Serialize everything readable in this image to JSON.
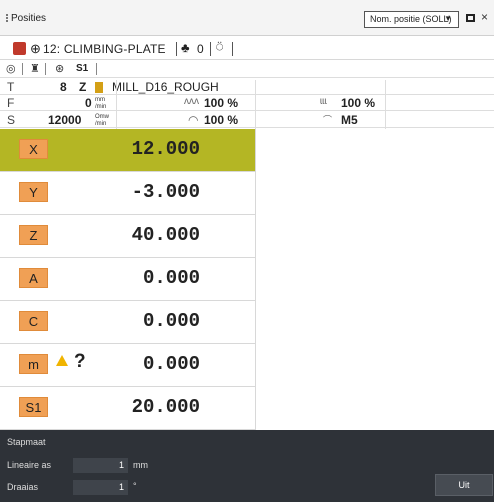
{
  "window": {
    "title": "Posities",
    "mode_select": "Nom. positie (SOLL)",
    "mode_caret": "▼",
    "close_symbol": "×"
  },
  "status": {
    "datum_symbol": "⊕",
    "program": "12: CLIMBING-PLATE",
    "pallet_symbol": "♣",
    "pallet_value": "0",
    "hand_symbol": "⍥",
    "spindle_label": "S1"
  },
  "tool_row": {
    "label": "T",
    "number": "8",
    "axis": "Z",
    "name": "MILL_D16_ROUGH"
  },
  "feed_row": {
    "label": "F",
    "value": "0",
    "unit_top": "mm",
    "unit_bottom": "/min",
    "override": "100 %",
    "rapid_override": "100 %"
  },
  "spindle_row": {
    "label": "S",
    "value": "12000",
    "unit_top": "Omw",
    "unit_bottom": "/min",
    "override": "100 %",
    "mfunction": "M5"
  },
  "positions": [
    {
      "axis": "X",
      "value": "12.000",
      "active": true,
      "warning": false
    },
    {
      "axis": "Y",
      "value": "-3.000",
      "active": false,
      "warning": false
    },
    {
      "axis": "Z",
      "value": "40.000",
      "active": false,
      "warning": false
    },
    {
      "axis": "A",
      "value": "0.000",
      "active": false,
      "warning": false
    },
    {
      "axis": "C",
      "value": "0.000",
      "active": false,
      "warning": false
    },
    {
      "axis": "m",
      "value": "0.000",
      "active": false,
      "warning": true,
      "extra": "?"
    },
    {
      "axis": "S1",
      "value": "20.000",
      "active": false,
      "warning": false
    }
  ],
  "stepsize": {
    "heading": "Stapmaat",
    "linear_label": "Lineaire as",
    "linear_value": "1",
    "linear_unit": "mm",
    "rotary_label": "Draaias",
    "rotary_value": "1",
    "rotary_unit": "°",
    "off_button": "Uit"
  },
  "colors": {
    "active_row": "#b4b624",
    "axis_badge": "#f0a055",
    "warning": "#f0b400",
    "bottom_panel": "#2e3238"
  }
}
